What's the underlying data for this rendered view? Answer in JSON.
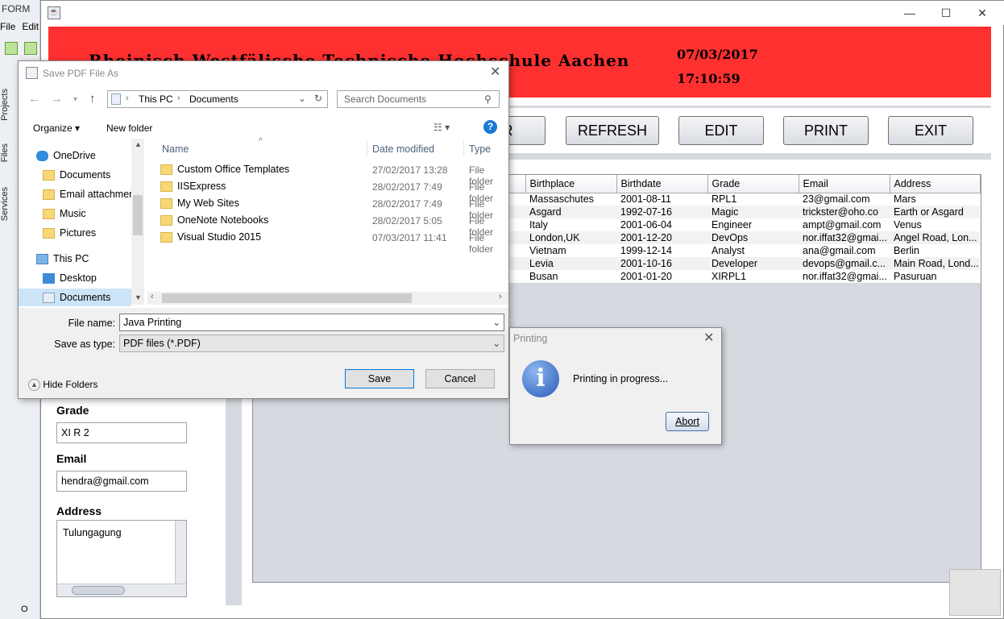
{
  "ide": {
    "title": "FORM",
    "menu": [
      "File",
      "Edit"
    ],
    "side_tabs": [
      "Projects",
      "Files",
      "Services"
    ],
    "bottom_label": "O"
  },
  "app": {
    "school_name": "Rheinisch-Westfälische Technische Hochschule Aachen",
    "date": "07/03/2017",
    "time": "17:10:59",
    "buttons": [
      "AR",
      "REFRESH",
      "EDIT",
      "PRINT",
      "EXIT"
    ],
    "table": {
      "columns": [
        "Birthplace",
        "Birthdate",
        "Grade",
        "Email",
        "Address"
      ],
      "rows": [
        [
          "Massaschutes",
          "2001-08-11",
          "RPL1",
          "23@gmail.com",
          "Mars"
        ],
        [
          "Asgard",
          "1992-07-16",
          "Magic",
          "trickster@oho.co",
          "Earth or Asgard"
        ],
        [
          "Italy",
          "2001-06-04",
          "Engineer",
          "ampt@gmail.com",
          "Venus"
        ],
        [
          "London,UK",
          "2001-12-20",
          "DevOps",
          "nor.iffat32@gmai...",
          "Angel Road, Lon..."
        ],
        [
          "Vietnam",
          "1999-12-14",
          "Analyst",
          "ana@gmail.com",
          "Berlin"
        ],
        [
          "Levia",
          "2001-10-16",
          "Developer",
          "devops@gmail.c...",
          "Main Road, Lond..."
        ],
        [
          "Busan",
          "2001-01-20",
          "XIRPL1",
          "nor.iffat32@gmai...",
          "Pasuruan"
        ]
      ]
    },
    "form": {
      "grade_label": "Grade",
      "grade_value": "XI R 2",
      "email_label": "Email",
      "email_value": "hendra@gmail.com",
      "address_label": "Address",
      "address_value": "Tulungagung"
    }
  },
  "save_dialog": {
    "title": "Save PDF File As",
    "path": [
      "This PC",
      "Documents"
    ],
    "search_placeholder": "Search Documents",
    "organize": "Organize",
    "new_folder": "New folder",
    "nav": {
      "onedrive": "OneDrive",
      "items": [
        "Documents",
        "Email attachmer",
        "Music",
        "Pictures"
      ],
      "this_pc": "This PC",
      "pc_items": [
        "Desktop",
        "Documents"
      ]
    },
    "columns": [
      "Name",
      "Date modified",
      "Type"
    ],
    "files": [
      {
        "name": "Custom Office Templates",
        "date": "27/02/2017 13:28",
        "type": "File folder"
      },
      {
        "name": "IISExpress",
        "date": "28/02/2017 7:49",
        "type": "File folder"
      },
      {
        "name": "My Web Sites",
        "date": "28/02/2017 7:49",
        "type": "File folder"
      },
      {
        "name": "OneNote Notebooks",
        "date": "28/02/2017 5:05",
        "type": "File folder"
      },
      {
        "name": "Visual Studio 2015",
        "date": "07/03/2017 11:41",
        "type": "File folder"
      }
    ],
    "file_name_label": "File name:",
    "file_name_value": "Java Printing",
    "save_type_label": "Save as type:",
    "save_type_value": "PDF files (*.PDF)",
    "hide_folders": "Hide Folders",
    "save": "Save",
    "cancel": "Cancel"
  },
  "print_dialog": {
    "title": "Printing",
    "message": "Printing in progress...",
    "abort": "Abort"
  }
}
